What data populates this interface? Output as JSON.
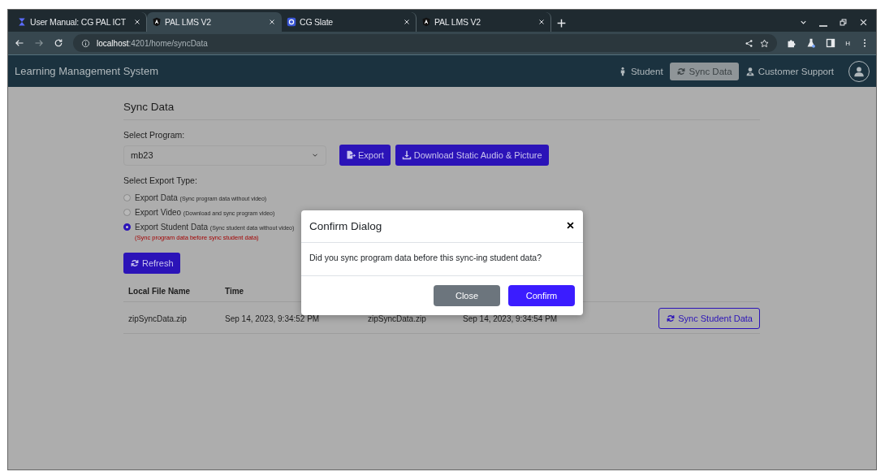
{
  "browser": {
    "tabs": [
      {
        "title": "User Manual: CG PAL ICT",
        "selected": false
      },
      {
        "title": "PAL LMS V2",
        "selected": true
      },
      {
        "title": "CG Slate",
        "selected": false
      },
      {
        "title": "PAL LMS V2",
        "selected": false
      }
    ],
    "address": {
      "host": "localhost",
      "path": ":4201/home/syncData"
    },
    "profile": "H"
  },
  "app": {
    "title": "Learning Management System",
    "nav": [
      {
        "label": "Student",
        "selected": false
      },
      {
        "label": "Sync Data",
        "selected": true
      },
      {
        "label": "Customer Support",
        "selected": false
      }
    ]
  },
  "page": {
    "heading": "Sync Data",
    "program_label": "Select Program:",
    "program_value": "mb23",
    "buttons": [
      {
        "label": "Export"
      },
      {
        "label": "Download Static Audio & Picture"
      }
    ],
    "export_type_label": "Select Export Type:",
    "export_types": [
      {
        "label": "Export Data",
        "note": "(Sync program data without video)",
        "selected": false
      },
      {
        "label": "Export Video",
        "note": "(Download and sync program video)",
        "selected": false
      },
      {
        "label": "Export Student Data",
        "note": "(Sync student data without video)",
        "selected": true,
        "warning": "(Sync program data before sync student data)"
      }
    ],
    "refresh": "Refresh",
    "table": {
      "columns": [
        "Local File Name",
        "Time"
      ],
      "rows": [
        {
          "cells": [
            "zipSyncData.zip",
            "Sep 14, 2023, 9:34:52 PM",
            "zipSyncData.zip",
            "Sep 14, 2023, 9:34:54 PM"
          ],
          "action": "Sync Student Data"
        }
      ]
    }
  },
  "dialog": {
    "title": "Confirm Dialog",
    "message": "Did you sync program data before this sync-ing student data?",
    "buttons": [
      {
        "label": "Close",
        "kind": "secondary"
      },
      {
        "label": "Confirm",
        "kind": "primary"
      }
    ]
  }
}
